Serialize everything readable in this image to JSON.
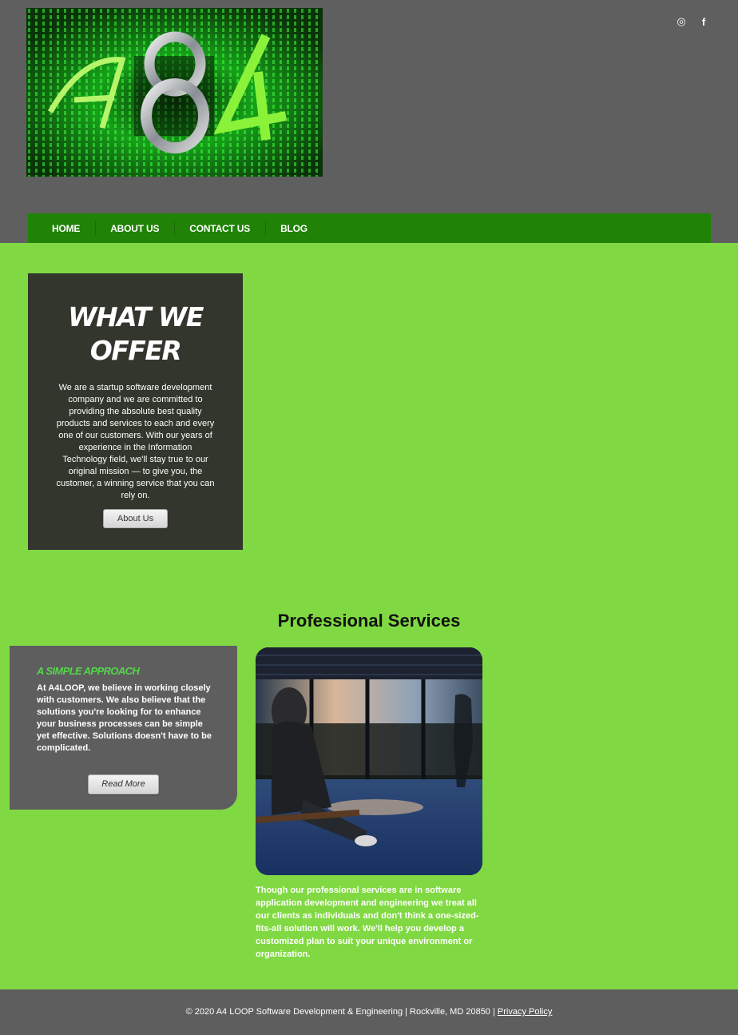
{
  "header": {
    "logo_text": "A84",
    "social": [
      {
        "name": "instagram-icon",
        "glyph": "◎"
      },
      {
        "name": "facebook-icon",
        "glyph": "f"
      }
    ]
  },
  "nav": {
    "items": [
      {
        "label": "HOME"
      },
      {
        "label": "ABOUT US"
      },
      {
        "label": "CONTACT US"
      },
      {
        "label": "BLOG"
      }
    ]
  },
  "offer": {
    "title_line1": "WHAT WE",
    "title_line2": "OFFER",
    "text": "We are a startup software development company and we are committed to providing the absolute best quality products and services to each and every one of our customers. With our years of experience in the Information Technology field, we'll stay true to our original mission — to give you, the customer, a winning service that you can rely on.",
    "button_label": "About Us"
  },
  "services": {
    "title": "Professional Services",
    "approach_title": "A SIMPLE APPROACH",
    "approach_text": "At A4LOOP, we believe in working closely with customers. We also believe that the solutions you're looking for to enhance your business processes can be simple yet effective. Solutions doesn't have to be complicated.",
    "read_more_label": "Read More",
    "description": "Though our professional services are in software application development and engineering we treat all our clients as individuals and don't think a one-sized-fits-all solution will work. We'll help you develop a customized plan to suit your unique environment or organization."
  },
  "footer": {
    "text": "© 2020 A4 LOOP Software Development & Engineering | Rockville, MD 20850 | ",
    "privacy_label": "Privacy Policy"
  },
  "colors": {
    "header_bg": "#5f5f60",
    "nav_bg": "#208207",
    "main_bg": "#80d942",
    "offer_bg": "#32362c",
    "approach_title": "#55d64a"
  }
}
